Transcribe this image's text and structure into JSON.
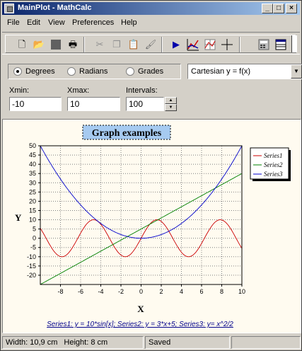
{
  "window": {
    "title": "MainPlot - MathCalc"
  },
  "menu": {
    "items": [
      "File",
      "Edit",
      "View",
      "Preferences",
      "Help"
    ]
  },
  "options": {
    "angle_modes": [
      "Degrees",
      "Radians",
      "Grades"
    ],
    "selected_angle_mode": "Degrees",
    "plot_type": "Cartesian y = f(x)"
  },
  "fields": {
    "xmin_label": "Xmin:",
    "xmin_value": "-10",
    "xmax_label": "Xmax:",
    "xmax_value": "10",
    "intervals_label": "Intervals:",
    "intervals_value": "100"
  },
  "chart": {
    "title": "Graph examples",
    "xlabel": "X",
    "ylabel": "Y",
    "footer": "Series1: y = 10*sin[x]; Series2: y = 3*x+5; Series3: y= x^2/2"
  },
  "chart_data": {
    "type": "line",
    "title": "Graph examples",
    "xlabel": "X",
    "ylabel": "Y",
    "xlim": [
      -10,
      10
    ],
    "ylim": [
      -25,
      50
    ],
    "x_ticks": [
      -8,
      -6,
      -4,
      -2,
      0,
      2,
      4,
      6,
      8,
      10
    ],
    "y_ticks": [
      -20,
      -15,
      -10,
      -5,
      0,
      5,
      10,
      15,
      20,
      25,
      30,
      35,
      40,
      45,
      50
    ],
    "grid": true,
    "legend_position": "top-right",
    "series": [
      {
        "name": "Series1",
        "formula": "y = 10*sin[x]",
        "color": "#cc0000"
      },
      {
        "name": "Series2",
        "formula": "y = 3*x+5",
        "color": "#008000"
      },
      {
        "name": "Series3",
        "formula": "y= x^2/2",
        "color": "#0000cc"
      }
    ]
  },
  "status": {
    "width": "Width: 10,9 cm",
    "height": "Height: 8 cm",
    "state": "Saved"
  }
}
